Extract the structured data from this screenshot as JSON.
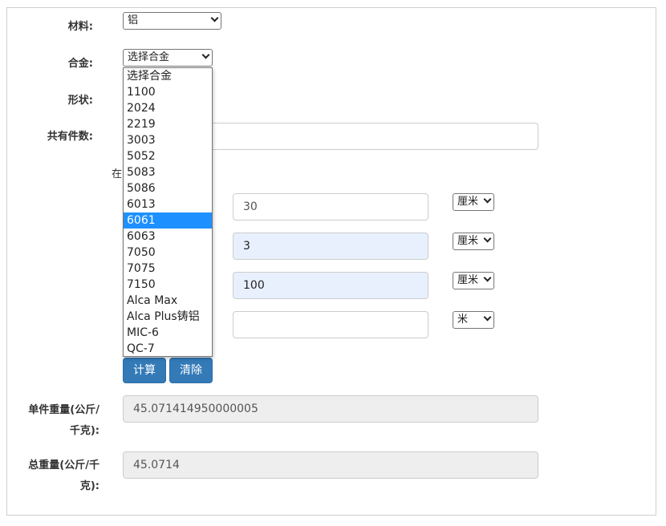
{
  "form": {
    "material": {
      "label": "材料:",
      "value": "铝"
    },
    "alloy": {
      "label": "合金:",
      "value": "选择合金"
    },
    "shape": {
      "label": "形状:"
    },
    "count": {
      "label": "共有件数:"
    },
    "partial_text": "在",
    "dim1": {
      "value": "30",
      "unit": "厘米"
    },
    "dim2": {
      "value": "3",
      "unit": "厘米"
    },
    "dim3": {
      "value": "100",
      "unit": "厘米"
    },
    "dim4": {
      "value": "",
      "unit": "米"
    },
    "calc_label": "计算",
    "clear_label": "清除",
    "unit_weight": {
      "label_line1": "单件重量(公斤/",
      "label_line2": "千克):",
      "value": "45.071414950000005"
    },
    "total_weight": {
      "label_line1": "总重量(公斤/千",
      "label_line2": "克):",
      "value": "45.0714"
    }
  },
  "alloy_dropdown": {
    "options": [
      "选择合金",
      "1100",
      "2024",
      "2219",
      "3003",
      "5052",
      "5083",
      "5086",
      "6013",
      "6061",
      "6063",
      "7050",
      "7075",
      "7150",
      "Alca Max",
      "Alca Plus铸铝",
      "MIC-6",
      "QC-7"
    ],
    "highlighted": "6061"
  },
  "colors": {
    "accent": "#337ab7",
    "highlight": "#1e90ff",
    "autofill": "#e8f0fe"
  }
}
